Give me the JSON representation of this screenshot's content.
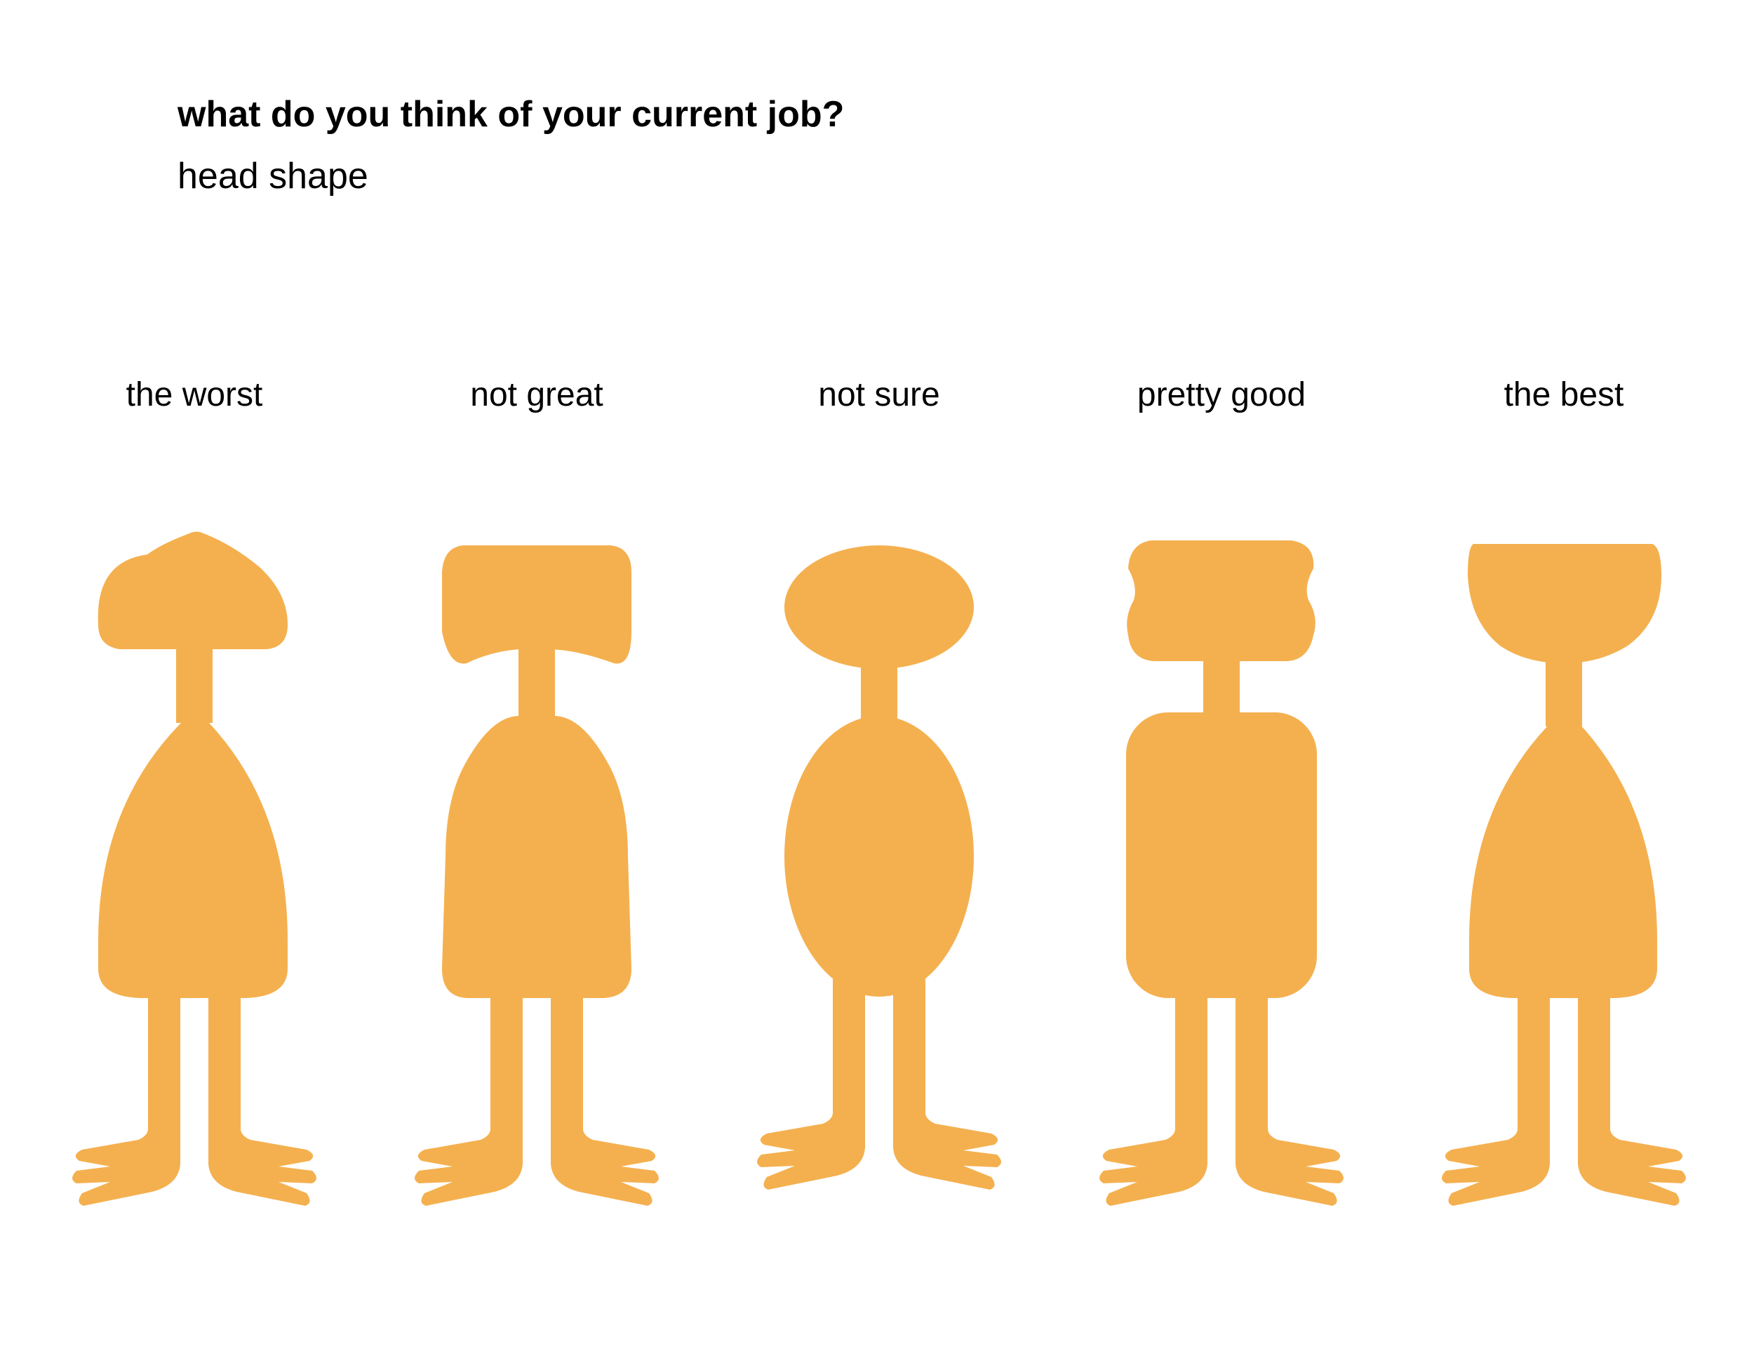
{
  "header": {
    "title": "what do you think of your current job?",
    "subtitle": "head shape"
  },
  "colors": {
    "figure_fill": "#F4B04F",
    "text": "#000000",
    "background": "#FFFFFF"
  },
  "figures": [
    {
      "label": "the worst",
      "head_shape": "dome"
    },
    {
      "label": "not great",
      "head_shape": "drooping-block"
    },
    {
      "label": "not sure",
      "head_shape": "oval"
    },
    {
      "label": "pretty good",
      "head_shape": "wavy-block"
    },
    {
      "label": "the best",
      "head_shape": "bowl"
    }
  ]
}
